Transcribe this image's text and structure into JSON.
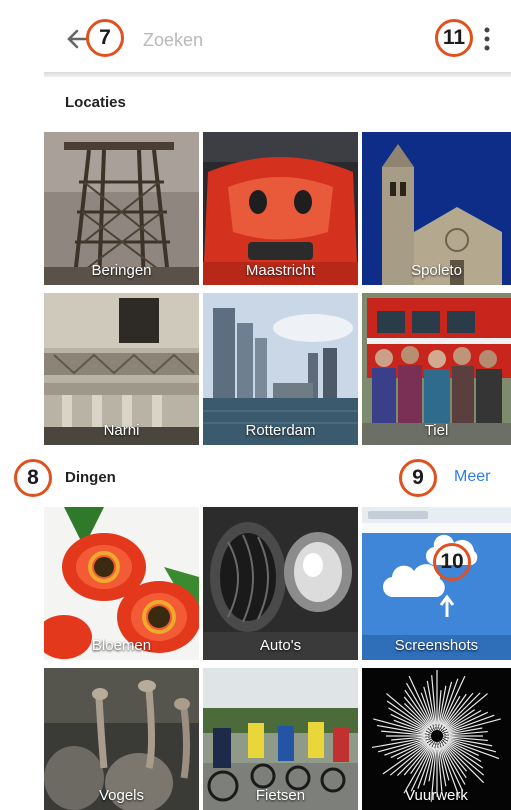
{
  "header": {
    "search_placeholder": "Zoeken",
    "back_icon": "arrow-left-icon",
    "menu_icon": "more-vert-icon"
  },
  "markers": {
    "back": "7",
    "menu": "11",
    "things_section": "8",
    "more": "9",
    "screenshots": "10"
  },
  "locations": {
    "title": "Locaties",
    "items": [
      {
        "label": "Beringen"
      },
      {
        "label": "Maastricht"
      },
      {
        "label": "Spoleto"
      },
      {
        "label": "Narni"
      },
      {
        "label": "Rotterdam"
      },
      {
        "label": "Tiel"
      }
    ]
  },
  "things": {
    "title": "Dingen",
    "more_label": "Meer",
    "items": [
      {
        "label": "Bloemen"
      },
      {
        "label": "Auto's"
      },
      {
        "label": "Screenshots"
      },
      {
        "label": "Vogels"
      },
      {
        "label": "Fietsen"
      },
      {
        "label": "Vuurwerk"
      }
    ]
  },
  "colors": {
    "accent": "#2f7dea",
    "marker": "#e0511f"
  }
}
